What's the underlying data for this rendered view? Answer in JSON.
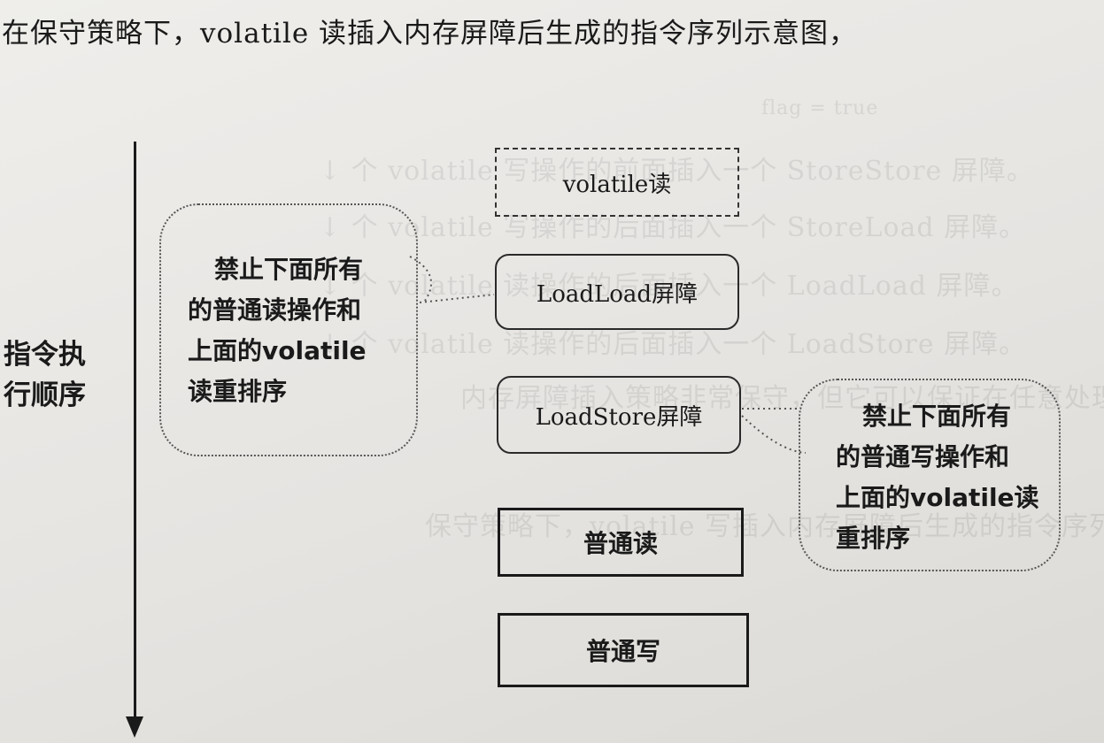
{
  "caption": "在保守策略下，volatile 读插入内存屏障后生成的指令序列示意图，",
  "axis": {
    "label_line1": "指令执",
    "label_line2": "行顺序"
  },
  "boxes": {
    "volatile_read": "volatile读",
    "loadload_barrier": "LoadLoad屏障",
    "loadstore_barrier": "LoadStore屏障",
    "normal_read": "普通读",
    "normal_write": "普通写"
  },
  "callouts": {
    "left": [
      "禁止下面所有",
      "的普通读操作和",
      "上面的volatile",
      "读重排序"
    ],
    "right": [
      "禁止下面所有",
      "的普通写操作和",
      "上面的volatile读",
      "重排序"
    ]
  }
}
